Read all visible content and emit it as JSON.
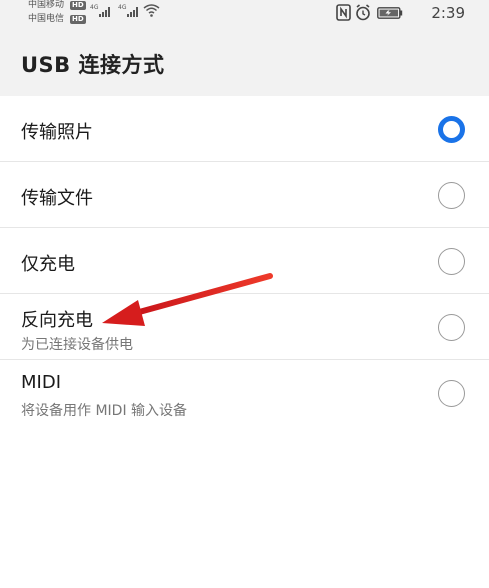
{
  "status_bar": {
    "carrier_1": "中国移动",
    "carrier_2": "中国电信",
    "hd_badge": "HD",
    "network_type": "4G",
    "time": "2:39"
  },
  "header": {
    "title": "USB 连接方式"
  },
  "options": [
    {
      "title": "传输照片",
      "subtitle": "",
      "selected": true
    },
    {
      "title": "传输文件",
      "subtitle": "",
      "selected": false
    },
    {
      "title": "仅充电",
      "subtitle": "",
      "selected": false
    },
    {
      "title": "反向充电",
      "subtitle": "为已连接设备供电",
      "selected": false
    },
    {
      "title": "MIDI",
      "subtitle": "将设备用作 MIDI 输入设备",
      "selected": false
    }
  ],
  "colors": {
    "accent": "#1a73e8",
    "annotation_arrow": "#e0261c",
    "header_background": "#f2f2f2"
  },
  "icons": {
    "nfc": "nfc-icon",
    "alarm": "alarm-icon",
    "battery": "battery-icon",
    "wifi": "wifi-icon",
    "signal": "signal-icon"
  }
}
